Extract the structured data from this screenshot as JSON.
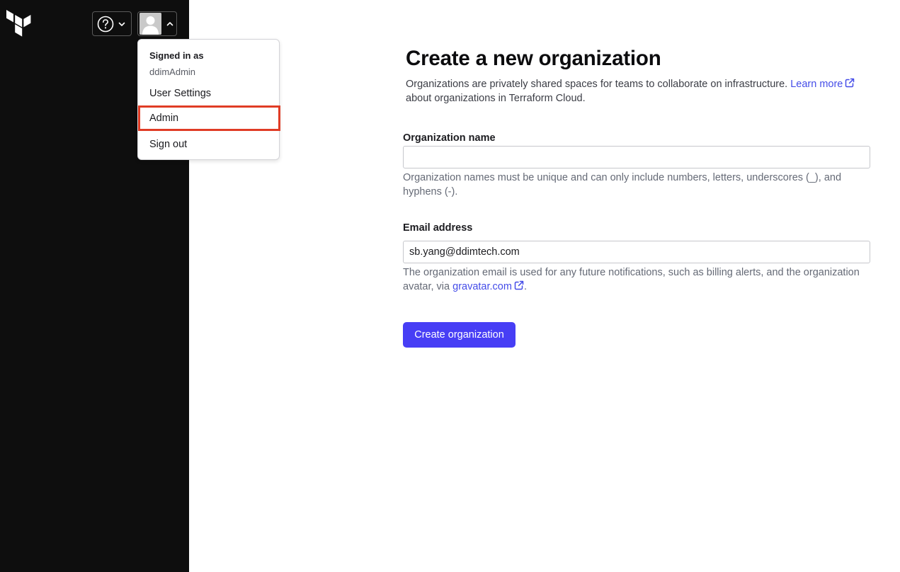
{
  "header": {
    "logo_icon": "terraform-logo",
    "help_menu_icon": "question-circle-icon",
    "user_menu_icon": "avatar-placeholder"
  },
  "user_menu": {
    "heading": "Signed in as",
    "username": "ddimAdmin",
    "items": [
      {
        "label": "User Settings"
      },
      {
        "label": "Admin"
      },
      {
        "label": "Sign out"
      }
    ],
    "highlight_color": "#e03c25"
  },
  "main": {
    "title": "Create a new organization",
    "intro_text": "Organizations are privately shared spaces for teams to collaborate on infrastructure.",
    "intro_link": "Learn more",
    "intro_suffix": "about organizations in Terraform Cloud.",
    "org_name": {
      "label": "Organization name",
      "value": "",
      "help": "Organization names must be unique and can only include numbers, letters, underscores (_), and hyphens (-)."
    },
    "email": {
      "label": "Email address",
      "value": "sb.yang@ddimtech.com",
      "help_prefix": "The organization email is used for any future notifications, such as billing alerts, and the organization avatar, via",
      "help_link": "gravatar.com",
      "help_suffix": "."
    },
    "submit_label": "Create organization"
  },
  "colors": {
    "sidebar": "#0e0e0e",
    "primary": "#473ef5",
    "link": "#444ce8"
  }
}
